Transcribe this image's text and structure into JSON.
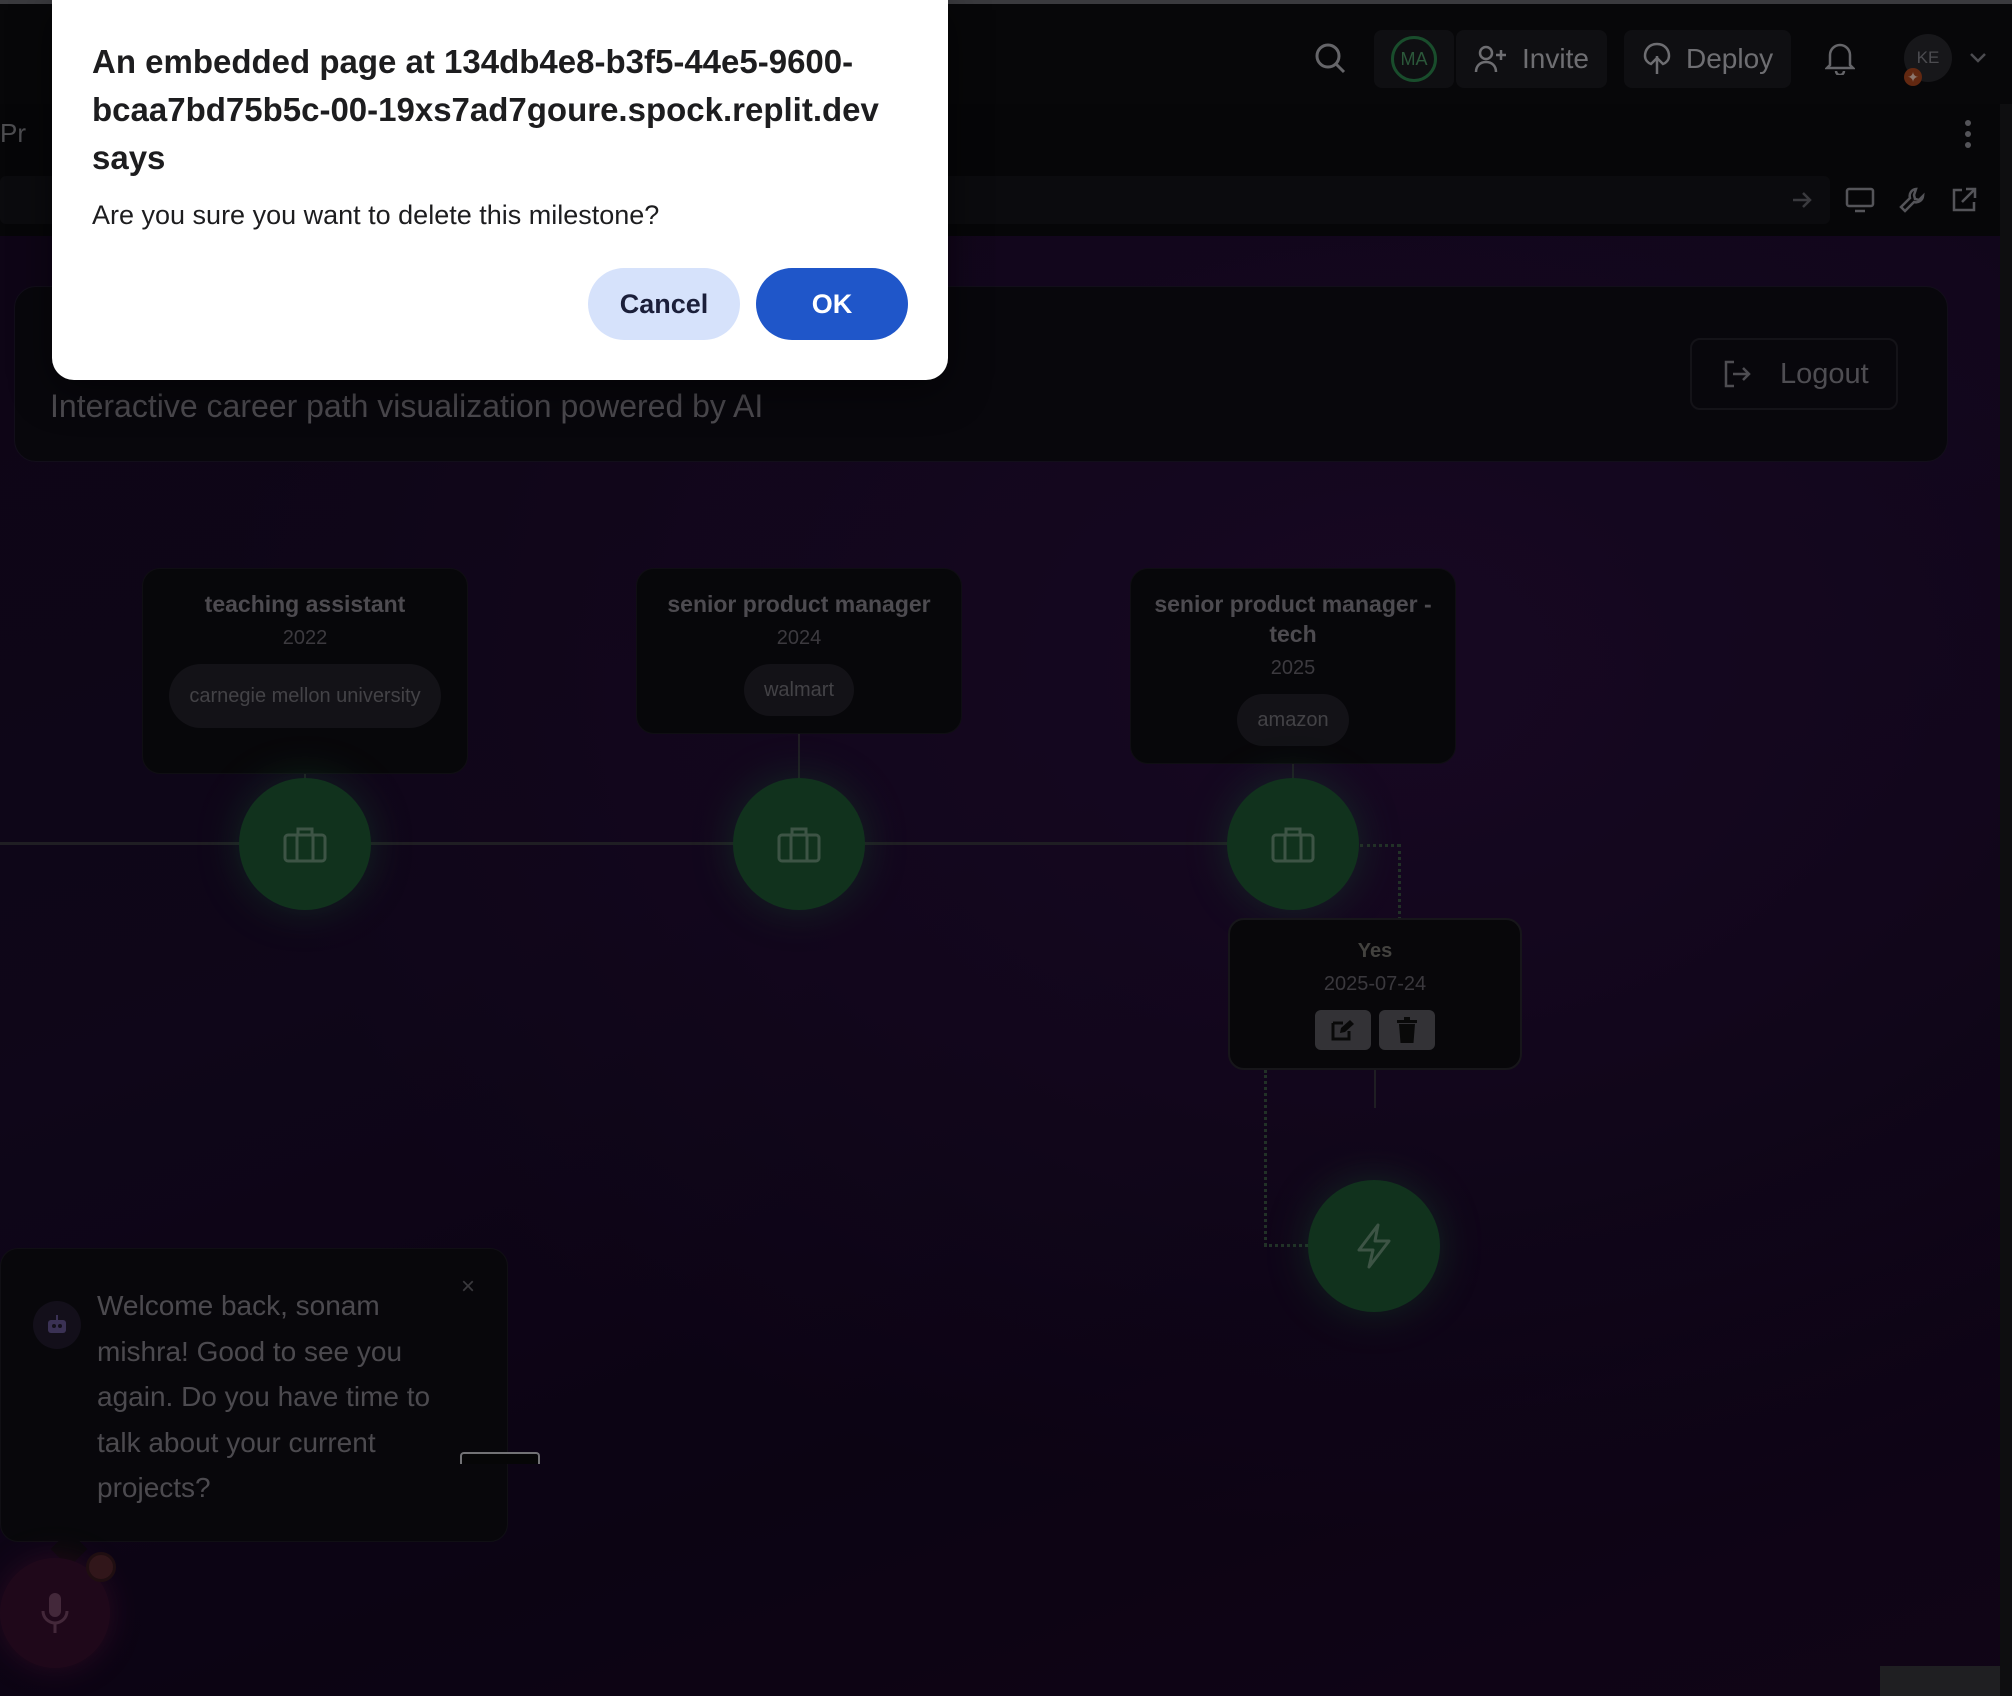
{
  "topbar": {
    "invite_label": "Invite",
    "deploy_label": "Deploy",
    "avatar_initials": "MA",
    "user_initials": "KE"
  },
  "tabbar": {
    "tab_label": "Pr"
  },
  "app": {
    "subtitle": "Interactive career path visualization powered by AI",
    "logout_label": "Logout",
    "jobs": [
      {
        "title": "teaching assistant",
        "year": "2022",
        "org": "carnegie mellon university"
      },
      {
        "title": "senior product manager",
        "year": "2024",
        "org": "walmart"
      },
      {
        "title": "senior product manager - tech",
        "year": "2025",
        "org": "amazon"
      }
    ],
    "milestone": {
      "title": "Yes",
      "date": "2025-07-24"
    },
    "chat": {
      "message": "Welcome back, sonam mishra! Good to see you again. Do you have time to talk about your current projects?",
      "close_glyph": "×"
    }
  },
  "dialog": {
    "title": "An embedded page at 134db4e8-b3f5-44e5-9600-bcaa7bd75b5c-00-19xs7ad7goure.spock.replit.dev says",
    "message": "Are you sure you want to delete this milestone?",
    "cancel_label": "Cancel",
    "ok_label": "OK"
  },
  "colors": {
    "accent_green": "#2e8d50",
    "dialog_ok": "#1f56c9",
    "dialog_cancel": "#d6e2fb"
  }
}
